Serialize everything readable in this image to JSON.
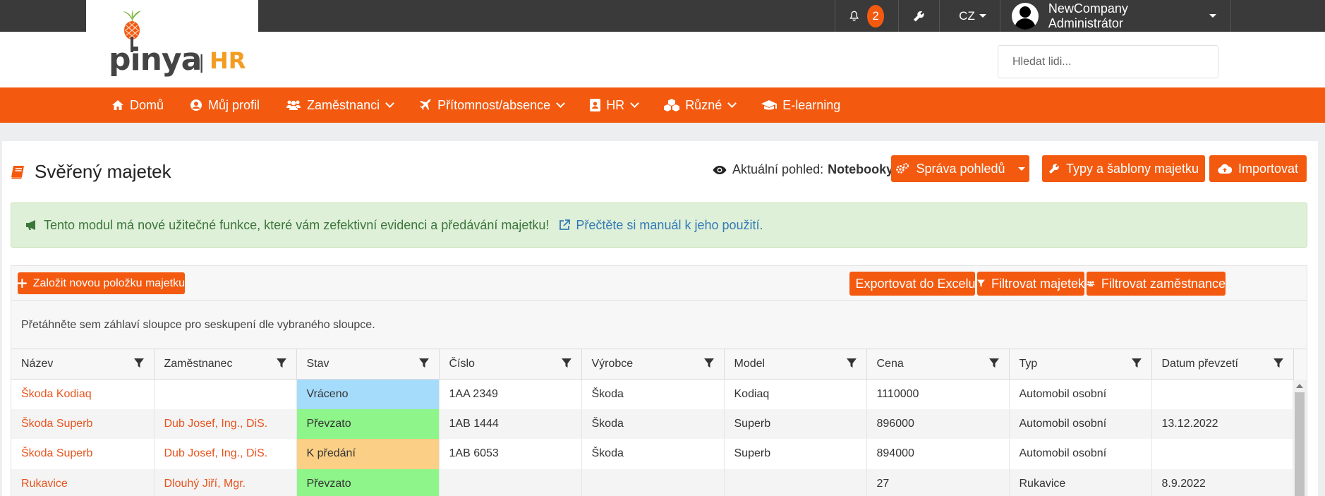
{
  "topbar": {
    "notification_count": "2",
    "language": "CZ",
    "user_name": "NewCompany Administrátor"
  },
  "logo": {
    "name": "pinya",
    "separator": "|",
    "suffix": "HR"
  },
  "search": {
    "placeholder": "Hledat lidi..."
  },
  "nav": {
    "items": [
      {
        "label": "Domů",
        "icon": "home-icon",
        "dropdown": false
      },
      {
        "label": "Můj profil",
        "icon": "user-circle-icon",
        "dropdown": false
      },
      {
        "label": "Zaměstnanci",
        "icon": "users-icon",
        "dropdown": true
      },
      {
        "label": "Přítomnost/absence",
        "icon": "plane-icon",
        "dropdown": true
      },
      {
        "label": "HR",
        "icon": "id-badge-icon",
        "dropdown": true
      },
      {
        "label": "Různé",
        "icon": "cubes-icon",
        "dropdown": true
      },
      {
        "label": "E-learning",
        "icon": "graduation-cap-icon",
        "dropdown": false
      }
    ]
  },
  "page": {
    "title": "Svěřený majetek",
    "view_prefix": "Aktuální pohled:",
    "view_name": "Notebooky",
    "manage_views": "Správa pohledů",
    "types_templates": "Typy a šablony majetku",
    "import": "Importovat"
  },
  "alert": {
    "text": "Tento modul má nové užitečné funkce, které vám zefektivní evidenci a předávání majetku!",
    "link": "Přečtěte si manuál k jeho použití."
  },
  "toolbar": {
    "new_item": "Založit novou položku majetku",
    "export": "Exportovat do Excelu",
    "filter_assets": "Filtrovat majetek",
    "filter_employees": "Filtrovat zaměstnance"
  },
  "grid": {
    "group_hint": "Přetáhněte sem záhlaví sloupce pro seskupení dle vybraného sloupce.",
    "columns": [
      "Název",
      "Zaměstnanec",
      "Stav",
      "Číslo",
      "Výrobce",
      "Model",
      "Cena",
      "Typ",
      "Datum převzetí"
    ],
    "rows": [
      [
        "Škoda Kodiaq",
        "",
        "Vráceno",
        "1AA 2349",
        "Škoda",
        "Kodiaq",
        "1110000",
        "Automobil osobní",
        ""
      ],
      [
        "Škoda Superb",
        "Dub Josef, Ing., DiS.",
        "Převzato",
        "1AB 1444",
        "Škoda",
        "Superb",
        "896000",
        "Automobil osobní",
        "13.12.2022"
      ],
      [
        "Škoda Superb",
        "Dub Josef, Ing., DiS.",
        "K předání",
        "1AB 6053",
        "Škoda",
        "Superb",
        "894000",
        "Automobil osobní",
        ""
      ],
      [
        "Rukavice",
        "Dlouhý Jiří, Mgr.",
        "Převzato",
        "",
        "",
        "",
        "27",
        "Rukavice",
        "8.9.2022"
      ]
    ],
    "status_colors": {
      "Vráceno": "#a6dcfb",
      "Převzato": "#8ef58a",
      "K předání": "#fbcf86"
    }
  },
  "colors": {
    "accent": "#f35a10",
    "topbar": "#3a3a3a",
    "link": "#e8541e"
  }
}
